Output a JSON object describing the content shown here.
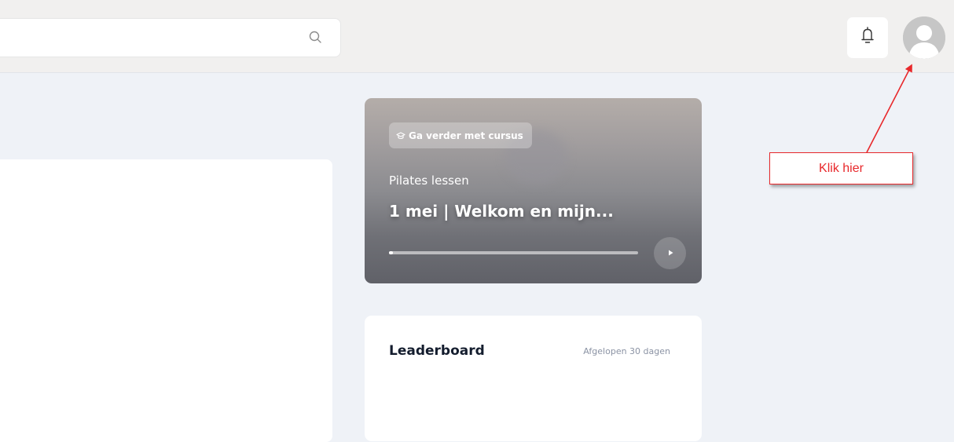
{
  "header": {
    "search": {
      "value": "",
      "placeholder": "",
      "icon": "search-icon"
    },
    "notifications_icon": "bell-icon",
    "avatar_icon": "user-avatar"
  },
  "course_card": {
    "badge": "Ga verder met cursus",
    "badge_icon": "graduation-cap-icon",
    "subtitle": "Pilates lessen",
    "title": "1 mei | Welkom en mijn...",
    "progress": 0.01,
    "play_icon": "play-icon"
  },
  "leaderboard": {
    "title": "Leaderboard",
    "period": "Afgelopen 30 dagen"
  },
  "annotation": {
    "callout_text": "Klik hier",
    "color": "#e8282b"
  }
}
